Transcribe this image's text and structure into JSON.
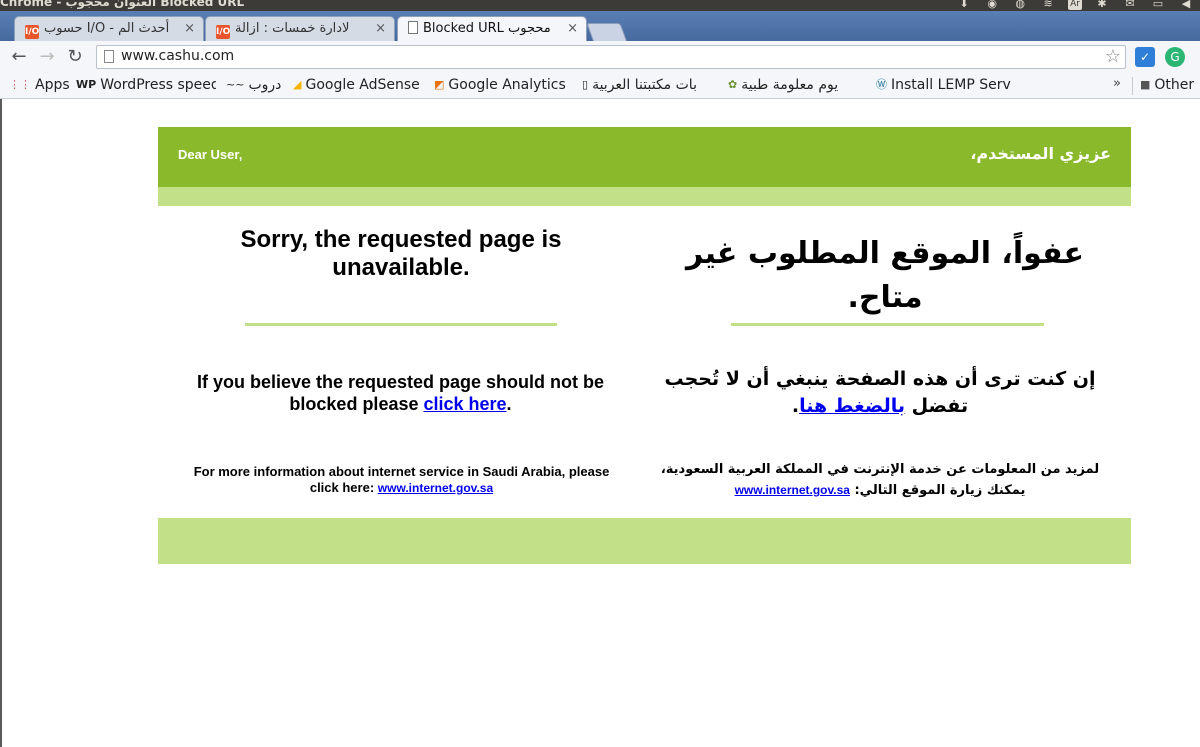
{
  "os": {
    "title": "Chrome - العنوان محجوب Blocked URL",
    "kbd_label": "Ar"
  },
  "tabs": [
    {
      "label": "حسوب I/O - أحدث الم",
      "favicon": "I/O"
    },
    {
      "label": "لادارة خمسات : ازالة",
      "favicon": "I/O"
    },
    {
      "label": "Blocked URL محجوب",
      "favicon": "doc"
    }
  ],
  "tab_close_glyph": "×",
  "toolbar": {
    "url": "www.cashu.com"
  },
  "bookmarks": {
    "items": [
      {
        "label": "Apps",
        "icon": "apps-grid-icon",
        "glyph": "⋮⋮"
      },
      {
        "label": "WordPress speed",
        "icon": "wp-icon",
        "glyph": "WP"
      },
      {
        "label": "دروب",
        "icon": "droob-icon",
        "glyph": "~~"
      },
      {
        "label": "Google AdSense",
        "icon": "adsense-icon",
        "glyph": "◢"
      },
      {
        "label": "Google Analytics",
        "icon": "analytics-icon",
        "glyph": "◩"
      },
      {
        "label": "بات مكتبتنا العربية",
        "icon": "page-icon",
        "glyph": "▯"
      },
      {
        "label": "يوم معلومة طبية",
        "icon": "leaf-icon",
        "glyph": "✿"
      },
      {
        "label": "Install LEMP Serv",
        "icon": "wordpress-icon",
        "glyph": "Ⓦ"
      },
      {
        "label": "Other",
        "icon": "folder-icon",
        "glyph": "■"
      }
    ],
    "more": "»"
  },
  "page": {
    "greeting_en": "Dear User,",
    "greeting_ar": "عزيزي المستخدم،",
    "heading_en": "Sorry, the requested page is unavailable.",
    "heading_ar": "عفواً، الموقع المطلوب غير متاح.",
    "unblock_en_prefix": "If you believe the requested page should not be blocked please ",
    "unblock_en_link": "click here",
    "unblock_en_suffix": ".",
    "unblock_ar_prefix": "إن كنت ترى أن هذه الصفحة ينبغي أن لا تُحجب تفضل ",
    "unblock_ar_link": "بالضغط هنا",
    "unblock_ar_suffix": ".",
    "info_en_prefix": "For more information about internet service in Saudi Arabia, please click here: ",
    "info_en_link": "www.internet.gov.sa",
    "info_ar_prefix": "لمزيد من المعلومات عن خدمة الإنترنت في المملكة العربية السعودية، يمكنك زيارة الموقع التالي: ",
    "info_ar_link": "www.internet.gov.sa"
  },
  "colors": {
    "header_green": "#8ab92c",
    "light_green": "#c2e087",
    "link_blue": "#0000ee"
  }
}
